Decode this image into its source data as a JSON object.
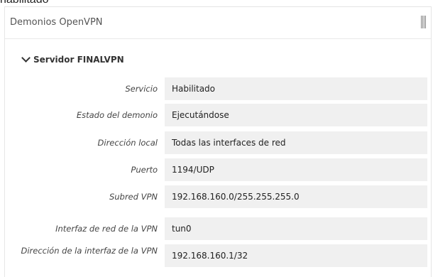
{
  "caption": "habilitado",
  "panel": {
    "title": "Demonios OpenVPN"
  },
  "section": {
    "title": "Servidor FINALVPN"
  },
  "rows": [
    {
      "label": "Servicio",
      "value": "Habilitado"
    },
    {
      "label": "Estado del demonio",
      "value": "Ejecutándose"
    },
    {
      "label": "Dirección local",
      "value": "Todas las interfaces de red"
    },
    {
      "label": "Puerto",
      "value": "1194/UDP"
    },
    {
      "label": "Subred VPN",
      "value": "192.168.160.0/255.255.255.0"
    },
    {
      "label": "Interfaz de red de la VPN",
      "value": "tun0"
    },
    {
      "label": "Dirección de la interfaz de la VPN",
      "value": "192.168.160.1/32"
    }
  ]
}
